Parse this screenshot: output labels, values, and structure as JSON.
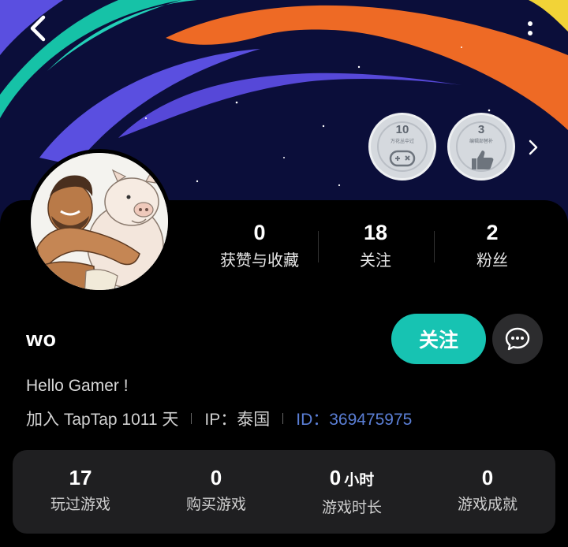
{
  "header": {
    "back_icon": "chevron-left-icon",
    "more_icon": "vertical-dots-icon"
  },
  "badges": [
    {
      "count": "10",
      "label": "万花丛中过",
      "icon": "gamepad-icon"
    },
    {
      "count": "3",
      "label": "编辑部替补",
      "icon": "thumbs-up-icon"
    }
  ],
  "profile": {
    "username": "wo",
    "bio": "Hello Gamer !",
    "join_text": "加入 TapTap 1011 天",
    "ip_text": "IP：泰国",
    "id_text": "ID：369475975"
  },
  "social_stats": [
    {
      "value": "0",
      "label": "获赞与收藏"
    },
    {
      "value": "18",
      "label": "关注"
    },
    {
      "value": "2",
      "label": "粉丝"
    }
  ],
  "actions": {
    "follow_label": "关注",
    "message_icon": "chat-bubble-icon"
  },
  "game_stats": [
    {
      "value": "17",
      "unit": "",
      "label": "玩过游戏"
    },
    {
      "value": "0",
      "unit": "",
      "label": "购买游戏"
    },
    {
      "value": "0",
      "unit": "小时",
      "label": "游戏时长"
    },
    {
      "value": "0",
      "unit": "",
      "label": "游戏成就"
    }
  ],
  "colors": {
    "accent": "#17c3b2",
    "id_link": "#5b7fd6",
    "panel": "#1f1f21",
    "banner_bg": "#0b0e3a"
  }
}
